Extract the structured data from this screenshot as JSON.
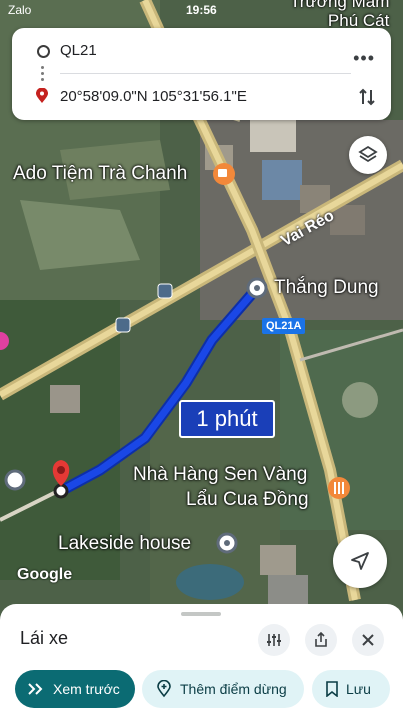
{
  "status_bar": {
    "carrier": "Zalo",
    "time": "19:56"
  },
  "route": {
    "origin": "QL21",
    "destination": "20°58'09.0\"N 105°31'56.1\"E",
    "eta": "1 phút"
  },
  "map_labels": {
    "top_place": "Trường Mầm\nPhú Cát",
    "cafe": "Ado Tiệm Trà Chanh",
    "road1": "Vai Réo",
    "start_place": "Thắng Dung",
    "road_badge": "QL21A",
    "restaurant_line1": "Nhà Hàng Sen Vàng",
    "restaurant_line2": "Lẩu Cua Đồng",
    "lakeside": "Lakeside house",
    "watermark": "Google"
  },
  "bottom_sheet": {
    "mode": "Lái xe",
    "preview_label": "Xem trước",
    "add_stop_label": "Thêm điểm dừng",
    "save_label": "Lưu"
  },
  "colors": {
    "route_blue": "#1a47e6",
    "accent_teal": "#0b6b73",
    "destination_red": "#e53935",
    "poi_orange": "#f2883a"
  },
  "icons": [
    "circle-origin-icon",
    "pin-icon",
    "more-icon",
    "swap-icon",
    "layers-icon",
    "navigate-icon",
    "tune-icon",
    "share-icon",
    "close-icon",
    "chevrons-icon",
    "add-location-icon",
    "bookmark-icon",
    "cafe-icon",
    "food-icon",
    "bus-icon"
  ]
}
